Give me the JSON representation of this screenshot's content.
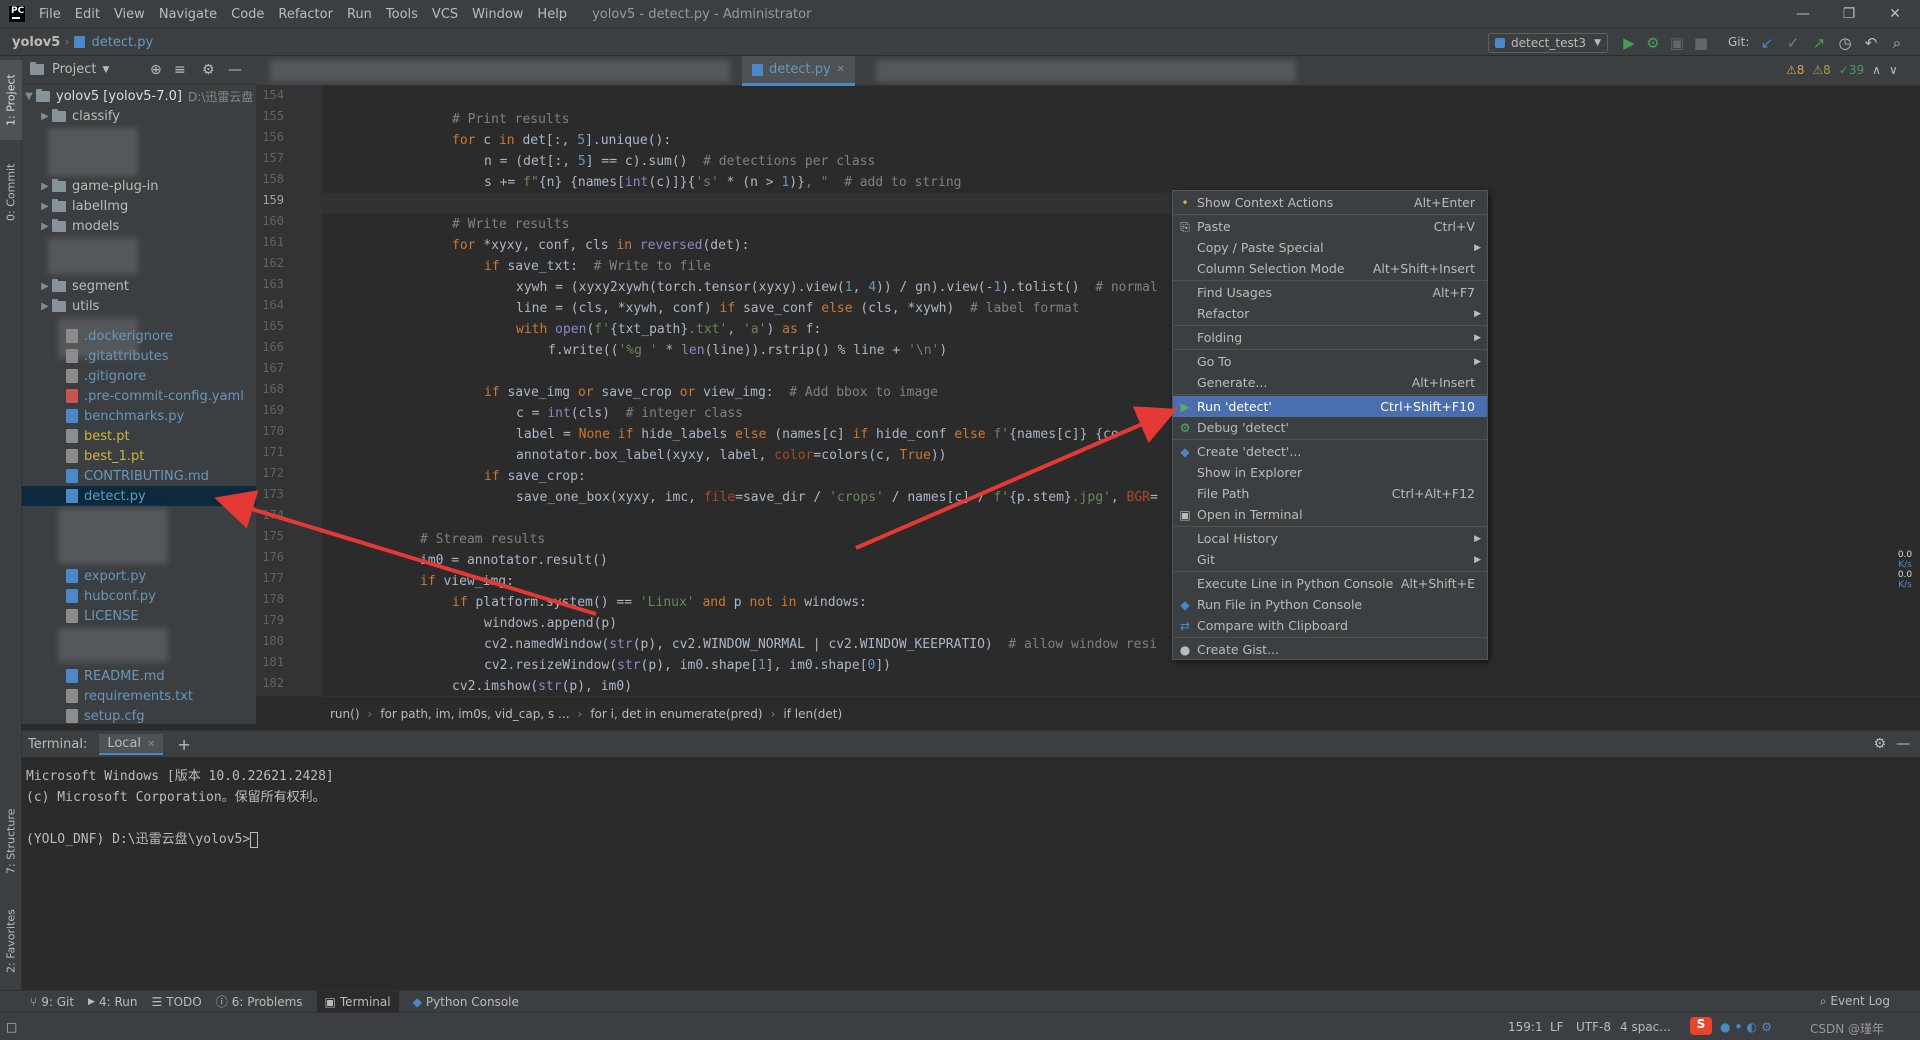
{
  "menubar": {
    "logo": "PC",
    "items": [
      "File",
      "Edit",
      "View",
      "Navigate",
      "Code",
      "Refactor",
      "Run",
      "Tools",
      "VCS",
      "Window",
      "Help"
    ],
    "title": "yolov5 - detect.py - Administrator"
  },
  "navbar": {
    "project": "yolov5",
    "file": "detect.py",
    "run_config": "detect_test3",
    "git_label": "Git:"
  },
  "left_strip": {
    "project_tab": "1: Project",
    "commit_tab": "0: Commit",
    "structure_tab": "7: Structure",
    "favorites_tab": "2: Favorites"
  },
  "project_panel": {
    "title": "Project",
    "root_name": "yolov5 [yolov5-7.0]",
    "root_path": "D:\\迅雷云盘",
    "items": [
      {
        "name": "classify",
        "type": "folder"
      },
      {
        "name": "game-plug-in",
        "type": "folder"
      },
      {
        "name": "labelImg",
        "type": "folder"
      },
      {
        "name": "models",
        "type": "folder"
      },
      {
        "name": "segment",
        "type": "folder"
      },
      {
        "name": "utils",
        "type": "folder"
      },
      {
        "name": ".dockerignore",
        "type": "file"
      },
      {
        "name": ".gitattributes",
        "type": "file"
      },
      {
        "name": ".gitignore",
        "type": "file"
      },
      {
        "name": ".pre-commit-config.yaml",
        "type": "yaml"
      },
      {
        "name": "benchmarks.py",
        "type": "py"
      },
      {
        "name": "best.pt",
        "type": "pt"
      },
      {
        "name": "best_1.pt",
        "type": "pt"
      },
      {
        "name": "CONTRIBUTING.md",
        "type": "md"
      },
      {
        "name": "detect.py",
        "type": "py"
      },
      {
        "name": "export.py",
        "type": "py"
      },
      {
        "name": "hubconf.py",
        "type": "py"
      },
      {
        "name": "LICENSE",
        "type": "file"
      },
      {
        "name": "README.md",
        "type": "md"
      },
      {
        "name": "requirements.txt",
        "type": "file"
      },
      {
        "name": "setup.cfg",
        "type": "file"
      }
    ]
  },
  "editor": {
    "tab_label": "detect.py",
    "inspections": {
      "warnings": "8",
      "weak": "8",
      "ok": "39"
    },
    "line_numbers": [
      "154",
      "155",
      "156",
      "157",
      "158",
      "159",
      "160",
      "161",
      "162",
      "163",
      "164",
      "165",
      "166",
      "167",
      "168",
      "169",
      "170",
      "171",
      "172",
      "173",
      "174",
      "175",
      "176",
      "177",
      "178",
      "179",
      "180",
      "181",
      "182"
    ],
    "breadcrumbs": [
      "run()",
      "for path, im, im0s, vid_cap, s ...",
      "for i, det in enumerate(pred)",
      "if len(det)"
    ]
  },
  "context_menu": {
    "items": [
      {
        "label": "Show Context Actions",
        "shortcut": "Alt+Enter",
        "icon": "bulb-icon"
      },
      {
        "label": "Paste",
        "shortcut": "Ctrl+V",
        "icon": "clipboard-icon"
      },
      {
        "label": "Copy / Paste Special",
        "shortcut": "",
        "submenu": true
      },
      {
        "label": "Column Selection Mode",
        "shortcut": "Alt+Shift+Insert"
      },
      {
        "label": "Find Usages",
        "shortcut": "Alt+F7"
      },
      {
        "label": "Refactor",
        "shortcut": "",
        "submenu": true
      },
      {
        "label": "Folding",
        "shortcut": "",
        "submenu": true
      },
      {
        "label": "Go To",
        "shortcut": "",
        "submenu": true
      },
      {
        "label": "Generate...",
        "shortcut": "Alt+Insert"
      },
      {
        "label": "Run 'detect'",
        "shortcut": "Ctrl+Shift+F10",
        "icon": "run-icon",
        "highlighted": true
      },
      {
        "label": "Debug 'detect'",
        "shortcut": "",
        "icon": "debug-icon"
      },
      {
        "label": "Create 'detect'...",
        "shortcut": "",
        "icon": "python-icon"
      },
      {
        "label": "Show in Explorer",
        "shortcut": ""
      },
      {
        "label": "File Path",
        "shortcut": "Ctrl+Alt+F12"
      },
      {
        "label": "Open in Terminal",
        "shortcut": "",
        "icon": "terminal-icon"
      },
      {
        "label": "Local History",
        "shortcut": "",
        "submenu": true
      },
      {
        "label": "Git",
        "shortcut": "",
        "submenu": true
      },
      {
        "label": "Execute Line in Python Console",
        "shortcut": "Alt+Shift+E"
      },
      {
        "label": "Run File in Python Console",
        "shortcut": "",
        "icon": "python-icon"
      },
      {
        "label": "Compare with Clipboard",
        "shortcut": "",
        "icon": "compare-icon"
      },
      {
        "label": "Create Gist...",
        "shortcut": "",
        "icon": "github-icon"
      }
    ]
  },
  "terminal": {
    "label": "Terminal:",
    "tab": "Local",
    "lines": [
      "Microsoft Windows [版本 10.0.22621.2428]",
      "(c) Microsoft Corporation。保留所有权利。",
      "",
      "(YOLO_DNF) D:\\迅雷云盘\\yolov5>"
    ]
  },
  "tool_windows": [
    "9: Git",
    "4: Run",
    "TODO",
    "6: Problems",
    "Terminal",
    "Python Console"
  ],
  "status": {
    "position": "159:1",
    "line_sep": "LF",
    "encoding": "UTF-8",
    "indent": "4 spac...",
    "event_log": "Event Log",
    "net_up": "0.0",
    "net_down": "0.0",
    "net_unit": "K/s",
    "watermark": "CSDN @瑾年"
  },
  "colors": {
    "accent": "#4b6eaf",
    "selection": "#0d293e",
    "arrow": "#e53935"
  }
}
